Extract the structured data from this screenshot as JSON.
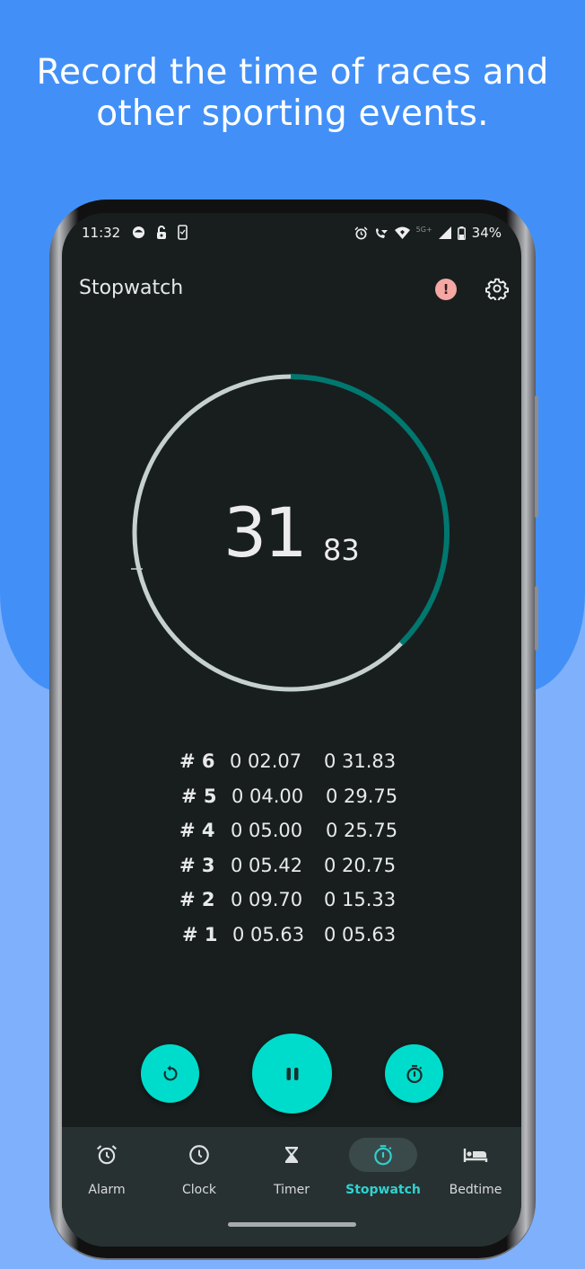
{
  "promo": {
    "headline_line1": "Record the time of races and",
    "headline_line2": "other sporting events."
  },
  "status_bar": {
    "time": "11:32",
    "left_icons": [
      "app-notification-icon",
      "lock-icon",
      "phone-check-icon"
    ],
    "right_icons": [
      "alarm-icon",
      "wifi-calling-icon",
      "wifi-icon",
      "signal-icon",
      "battery-icon"
    ],
    "network": "5G+",
    "battery_percent": "34%"
  },
  "app_bar": {
    "title": "Stopwatch",
    "alert_icon": "exclamation-icon",
    "settings_icon": "gear-icon"
  },
  "stopwatch": {
    "seconds": "31",
    "centiseconds": "83",
    "progress_fraction": 0.375,
    "colors": {
      "progress": "#00786f",
      "track": "#c6d0ce"
    }
  },
  "laps": [
    {
      "number": "# 6",
      "lap_time": "0 02.07",
      "total_time": "0 31.83"
    },
    {
      "number": "# 5",
      "lap_time": "0 04.00",
      "total_time": "0 29.75"
    },
    {
      "number": "# 4",
      "lap_time": "0 05.00",
      "total_time": "0 25.75"
    },
    {
      "number": "# 3",
      "lap_time": "0 05.42",
      "total_time": "0 20.75"
    },
    {
      "number": "# 2",
      "lap_time": "0 09.70",
      "total_time": "0 15.33"
    },
    {
      "number": "# 1",
      "lap_time": "0 05.63",
      "total_time": "0 05.63"
    }
  ],
  "controls": {
    "reset_icon": "reset-icon",
    "pause_icon": "pause-icon",
    "lap_icon": "stopwatch-lap-icon",
    "accent": "#00dccb"
  },
  "bottom_nav": {
    "items": [
      {
        "label": "Alarm",
        "icon": "alarm-icon"
      },
      {
        "label": "Clock",
        "icon": "clock-icon"
      },
      {
        "label": "Timer",
        "icon": "hourglass-icon"
      },
      {
        "label": "Stopwatch",
        "icon": "stopwatch-icon",
        "active": true
      },
      {
        "label": "Bedtime",
        "icon": "bed-icon"
      }
    ],
    "active_color": "#2fd2d1"
  }
}
